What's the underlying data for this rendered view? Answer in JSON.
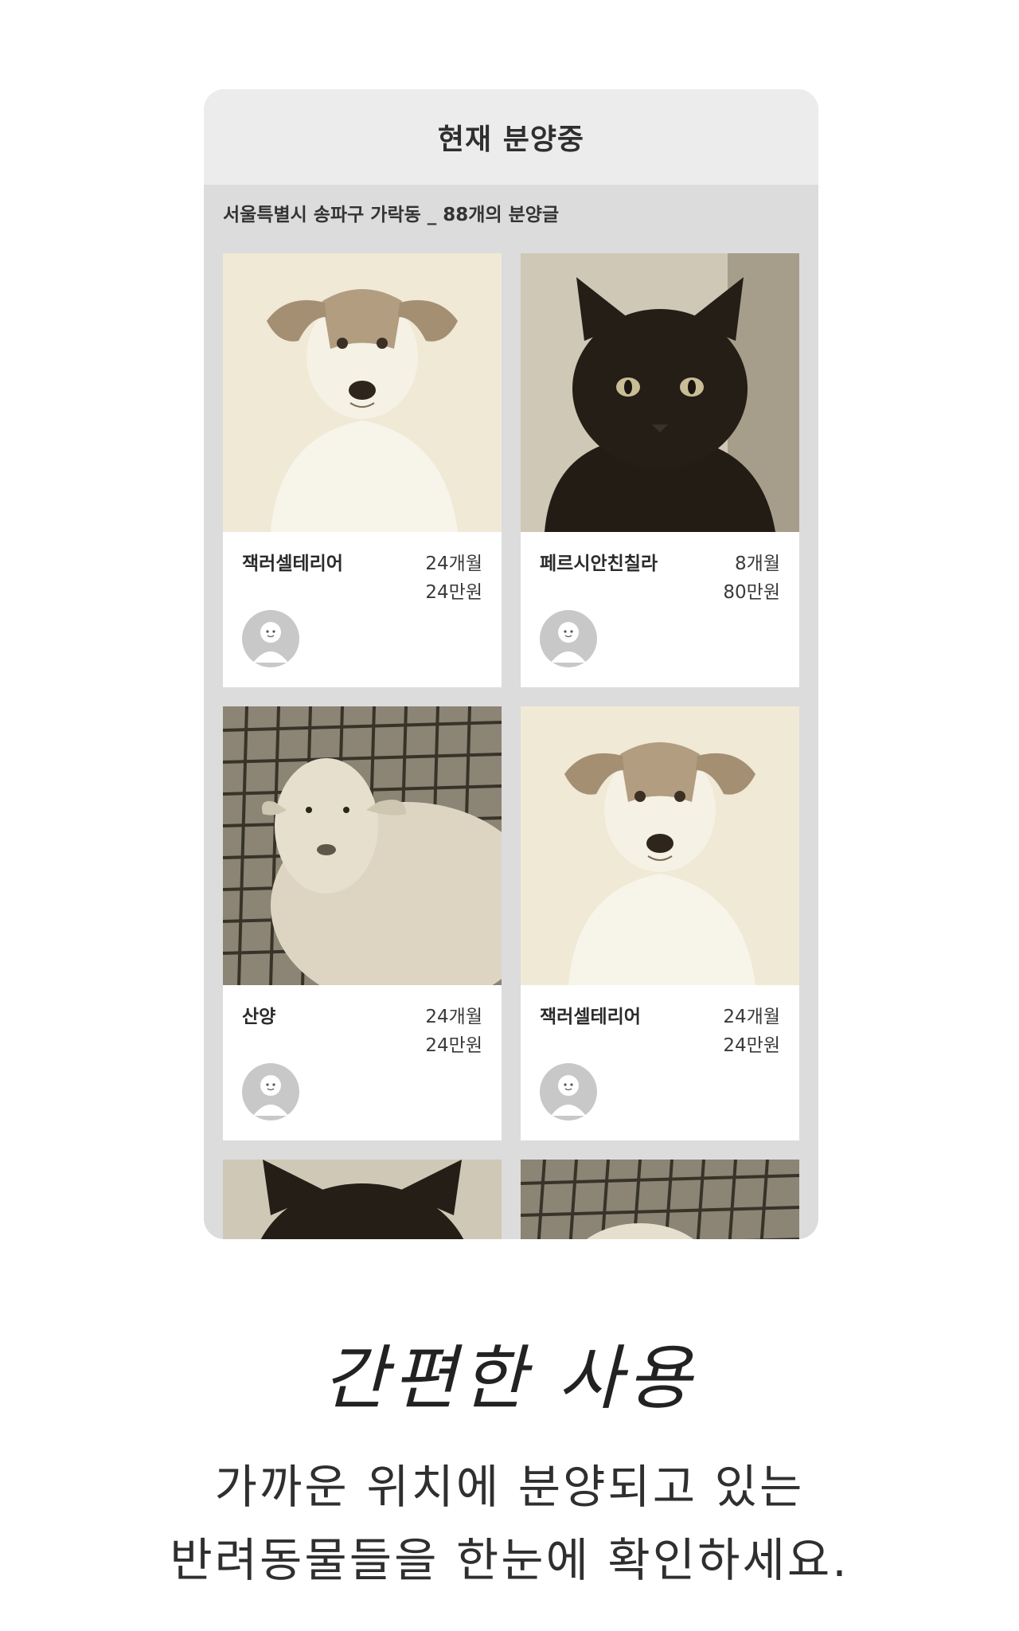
{
  "header": {
    "title": "현재 분양중"
  },
  "location_line": "서울특별시 송파구 가락동 _ 88개의 분양글",
  "cards": [
    {
      "name": "잭러셀테리어",
      "age": "24개월",
      "price": "24만원",
      "photo": "dog-photo"
    },
    {
      "name": "페르시안친칠라",
      "age": "8개월",
      "price": "80만원",
      "photo": "black-cat-photo"
    },
    {
      "name": "산양",
      "age": "24개월",
      "price": "24만원",
      "photo": "sheep-photo"
    },
    {
      "name": "잭러셀테리어",
      "age": "24개월",
      "price": "24만원",
      "photo": "dog-photo"
    }
  ],
  "caption": {
    "title": "간편한 사용",
    "line1": "가까운 위치에 분양되고 있는",
    "line2": "반려동물들을 한눈에 확인하세요."
  },
  "colors": {
    "photo_tone": "#efe9d6",
    "panel_bg": "#dcdcdc",
    "header_bg": "#ececec",
    "avatar": "#c8c8c8"
  }
}
